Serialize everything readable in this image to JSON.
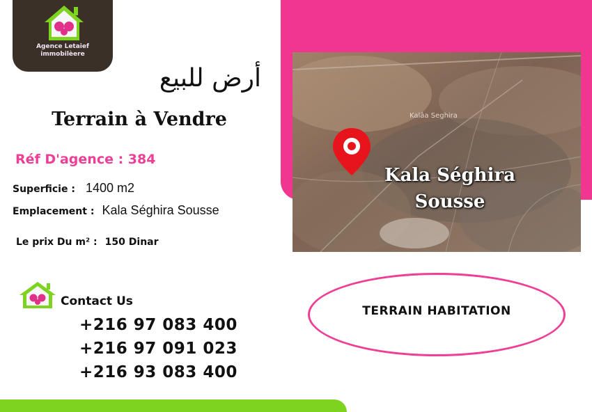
{
  "agency": {
    "name_line1": "Agence Letaief",
    "name_line2": "immobilèere"
  },
  "listing": {
    "title_ar": "أرض للبيع",
    "title_fr": "Terrain à Vendre",
    "ref": "Réf D'agence : 384",
    "area_label": "Superficie :",
    "area_value": "1400 m2",
    "location_label": "Emplacement :",
    "location_value": "Kala Séghira Sousse",
    "price_label": "Le prix Du m² :",
    "price_value": "150 Dinar",
    "category": "TERRAIN HABITATION"
  },
  "map": {
    "small_label": "Kalâa Seghira",
    "city_line1": "Kala Séghira",
    "city_line2": "Sousse"
  },
  "contact": {
    "label": "Contact Us",
    "phones": [
      "+216 97 083 400",
      "+216 97 091 023",
      "+216 93 083 400"
    ]
  },
  "colors": {
    "pink": "#f0368f",
    "green": "#7ed321",
    "logo_bg": "#3a3028",
    "ref_text": "#ef3e96"
  },
  "icons": [
    "house-logo-icon",
    "location-pin-icon"
  ]
}
